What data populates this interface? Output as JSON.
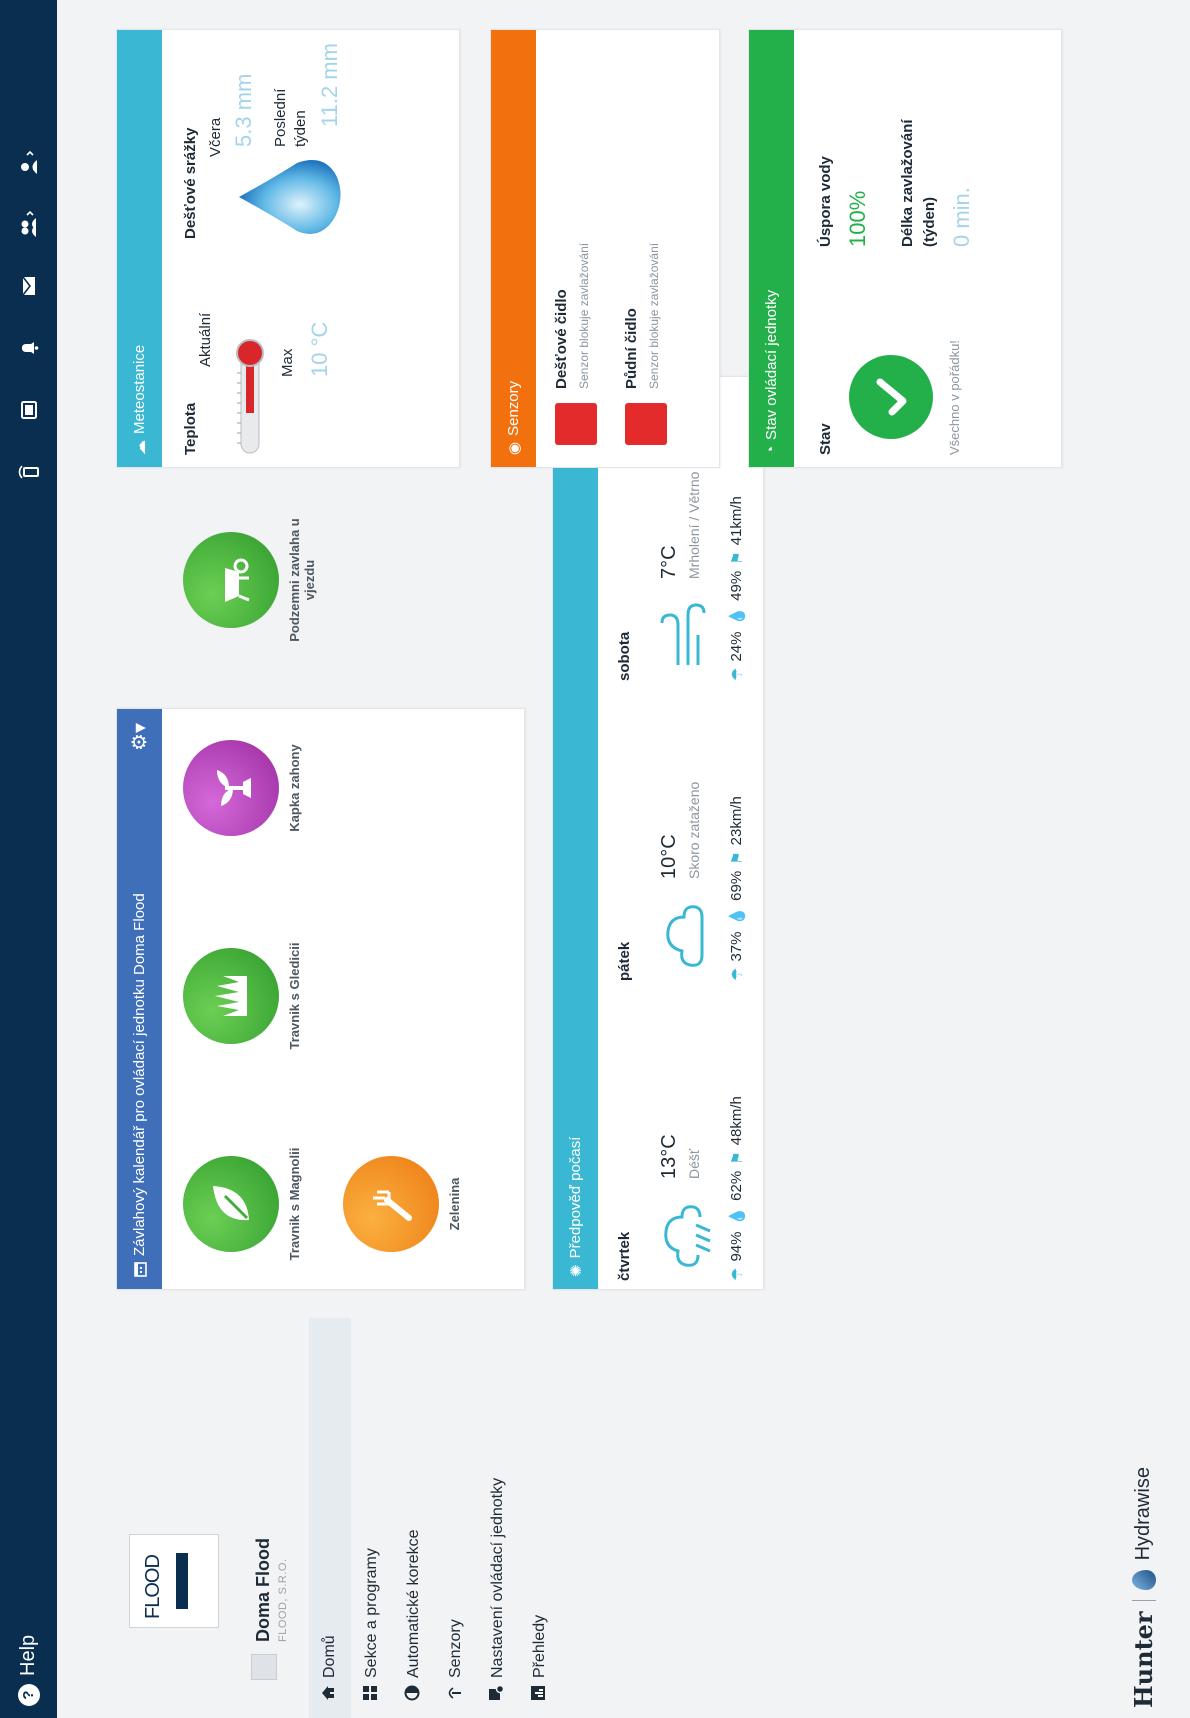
{
  "topbar": {
    "help_label": "Help",
    "icons": [
      "remote-icon",
      "tablet-icon",
      "bell-icon",
      "mail-icon",
      "users-icon",
      "user-icon"
    ]
  },
  "sidebar": {
    "logo_text": "FLOOD",
    "controller_name": "Doma Flood",
    "controller_sub": "FLOOD, S.R.O.",
    "items": [
      {
        "label": "Domů",
        "icon": "home-icon",
        "active": true
      },
      {
        "label": "Sekce a programy",
        "icon": "grid-icon"
      },
      {
        "label": "Automatické korekce",
        "icon": "adjust-icon"
      },
      {
        "label": "Senzory",
        "icon": "antenna-icon"
      },
      {
        "label": "Nastavení ovládací jednotky",
        "icon": "settings-icon"
      },
      {
        "label": "Přehledy",
        "icon": "chart-icon"
      }
    ],
    "brand_hunter": "Hunter",
    "brand_hydra": "Hydrawise"
  },
  "calendar": {
    "title": "Závlahový kalendář pro ovládací jednotku Doma Flood",
    "programs": [
      {
        "label": "Travnik s Magnolii",
        "color": "#3fae3a",
        "icon": "leaf-icon"
      },
      {
        "label": "Travnik s Gledicii",
        "color": "#3fae3a",
        "icon": "grass-icon"
      },
      {
        "label": "Kapka zahony",
        "color": "#b23fb8",
        "icon": "sprout-icon"
      },
      {
        "label": "Podzemni zavlaha u vjezdu",
        "color": "#3fae3a",
        "icon": "wheelbarrow-icon"
      },
      {
        "label": "Zelenina",
        "color": "#f08a1a",
        "icon": "fork-icon"
      }
    ]
  },
  "forecast": {
    "title": "Předpověď počasí",
    "days": [
      {
        "name": "čtvrtek",
        "temp": "13°C",
        "desc": "Déšť",
        "rain": "94%",
        "humidity": "62%",
        "wind": "48km/h",
        "icon": "rain-cloud-icon"
      },
      {
        "name": "pátek",
        "temp": "10°C",
        "desc": "Skoro zataženo",
        "rain": "37%",
        "humidity": "69%",
        "wind": "23km/h",
        "icon": "cloud-icon"
      },
      {
        "name": "sobota",
        "temp": "7°C",
        "desc": "Mrholení / Větrno",
        "rain": "24%",
        "humidity": "49%",
        "wind": "41km/h",
        "icon": "wind-icon"
      }
    ]
  },
  "meteo": {
    "title": "Meteostanice",
    "temp_label": "Teplota",
    "current_label": "Aktuální",
    "max_label": "Max",
    "max_value": "10 °C",
    "rain_label": "Dešťové srážky",
    "yesterday_label": "Včera",
    "yesterday_value": "5.3 mm",
    "week_label_1": "Poslední",
    "week_label_2": "týden",
    "week_value": "11.2 mm"
  },
  "sensors": {
    "title": "Senzory",
    "items": [
      {
        "name": "Dešťové čidlo",
        "desc": "Senzor blokuje zavlažování"
      },
      {
        "name": "Půdní čidlo",
        "desc": "Senzor blokuje zavlažování"
      }
    ]
  },
  "status": {
    "title": "Stav ovládací jednotky",
    "state_label": "Stav",
    "state_text": "Všechno v pořádku!",
    "saving_label": "Úspora vody",
    "saving_value": "100%",
    "duration_label_1": "Délka zavlažování",
    "duration_label_2": "(týden)",
    "duration_value": "0 min."
  },
  "colors": {
    "topbar": "#0a2e4f",
    "calendar": "#3e6fb8",
    "forecast": "#3ab8d3",
    "sensors": "#f2700d",
    "status": "#23b04a",
    "sensor_block": "#e32b2b"
  }
}
